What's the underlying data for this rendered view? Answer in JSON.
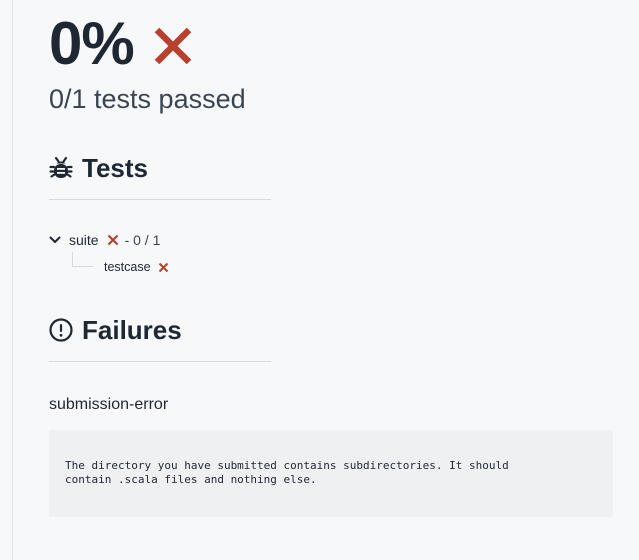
{
  "result": {
    "score": "0%",
    "summary": "0/1 tests passed",
    "status_icon": "x-icon",
    "fail_color": "#c0392b"
  },
  "tests_section": {
    "title": "Tests",
    "icon": "bug-icon",
    "suite": {
      "name": "suite",
      "count": "- 0 / 1",
      "expanded_icon": "chevron-down-icon",
      "status_icon": "x-icon",
      "cases": [
        {
          "name": "testcase",
          "status_icon": "x-icon"
        }
      ]
    }
  },
  "failures_section": {
    "title": "Failures",
    "icon": "exclamation-circle-icon",
    "items": [
      {
        "name": "submission-error",
        "message": "The directory you have submitted contains subdirectories. It should\ncontain .scala files and nothing else."
      }
    ]
  }
}
